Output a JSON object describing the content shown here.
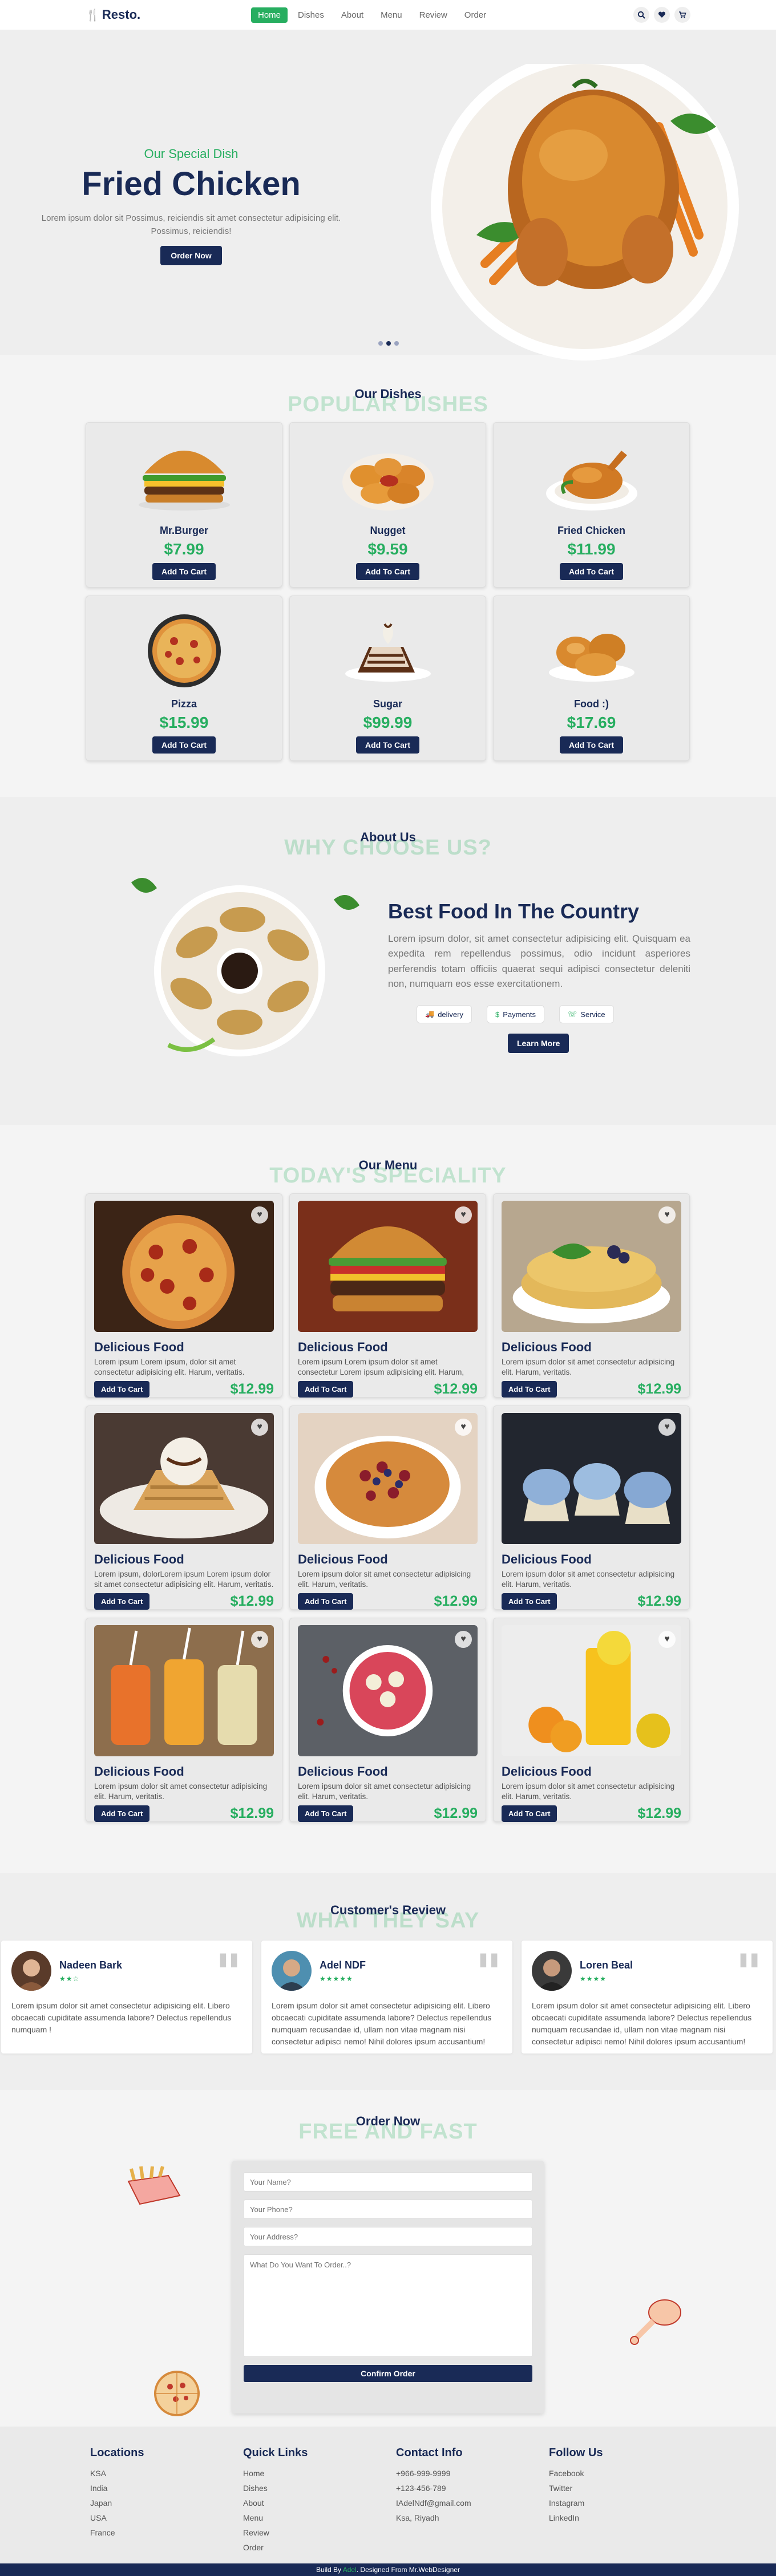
{
  "nav": {
    "logo": "Resto.",
    "links": [
      "Home",
      "Dishes",
      "About",
      "Menu",
      "Review",
      "Order"
    ],
    "icons": [
      "search-icon",
      "heart-icon",
      "cart-icon"
    ]
  },
  "hero": {
    "subtitle": "Our Special Dish",
    "title": "Fried Chicken",
    "description": "Lorem ipsum dolor sit Possimus, reiciendis sit amet consectetur adipisicing elit. Possimus, reiciendis!",
    "button": "Order Now"
  },
  "dishes": {
    "heading": "Our Dishes",
    "ghost": "POPULAR DISHES",
    "items": [
      {
        "name": "Mr.Burger",
        "price": "$7.99",
        "button": "Add To Cart"
      },
      {
        "name": "Nugget",
        "price": "$9.59",
        "button": "Add To Cart"
      },
      {
        "name": "Fried Chicken",
        "price": "$11.99",
        "button": "Add To Cart"
      },
      {
        "name": "Pizza",
        "price": "$15.99",
        "button": "Add To Cart"
      },
      {
        "name": "Sugar",
        "price": "$99.99",
        "button": "Add To Cart"
      },
      {
        "name": "Food :)",
        "price": "$17.69",
        "button": "Add To Cart"
      }
    ]
  },
  "about": {
    "heading": "About Us",
    "ghost": "WHY CHOOSE US?",
    "title": "Best Food In The Country",
    "text": "Lorem ipsum dolor, sit amet consectetur adipisicing elit. Quisquam ea expedita rem repellendus possimus, odio incidunt asperiores perferendis totam officiis quaerat sequi adipisci consectetur deleniti non, numquam eos esse exercitationem.",
    "badges": [
      "delivery",
      "Payments",
      "Service"
    ],
    "button": "Learn More"
  },
  "menu": {
    "heading": "Our Menu",
    "ghost": "TODAY'S SPECIALITY",
    "items": [
      {
        "title": "Delicious Food",
        "desc": "Lorem ipsum Lorem ipsum, dolor sit amet consectetur adipisicing elit. Harum, veritatis.",
        "price": "$12.99",
        "button": "Add To Cart"
      },
      {
        "title": "Delicious Food",
        "desc": "Lorem ipsum Lorem ipsum dolor sit amet consectetur Lorem ipsum adipisicing elit. Harum, veritatis.",
        "price": "$12.99",
        "button": "Add To Cart"
      },
      {
        "title": "Delicious Food",
        "desc": "Lorem ipsum dolor sit amet consectetur adipisicing elit. Harum, veritatis.",
        "price": "$12.99",
        "button": "Add To Cart"
      },
      {
        "title": "Delicious Food",
        "desc": "Lorem ipsum, dolorLorem ipsum Lorem ipsum dolor sit amet consectetur adipisicing elit. Harum, veritatis.",
        "price": "$12.99",
        "button": "Add To Cart"
      },
      {
        "title": "Delicious Food",
        "desc": "Lorem ipsum dolor sit amet consectetur adipisicing elit. Harum, veritatis.",
        "price": "$12.99",
        "button": "Add To Cart"
      },
      {
        "title": "Delicious Food",
        "desc": "Lorem ipsum dolor sit amet consectetur adipisicing elit. Harum, veritatis.",
        "price": "$12.99",
        "button": "Add To Cart"
      },
      {
        "title": "Delicious Food",
        "desc": "Lorem ipsum dolor sit amet consectetur adipisicing elit. Harum, veritatis.",
        "price": "$12.99",
        "button": "Add To Cart"
      },
      {
        "title": "Delicious Food",
        "desc": "Lorem ipsum dolor sit amet consectetur adipisicing elit. Harum, veritatis.",
        "price": "$12.99",
        "button": "Add To Cart"
      },
      {
        "title": "Delicious Food",
        "desc": "Lorem ipsum dolor sit amet consectetur adipisicing elit. Harum, veritatis.",
        "price": "$12.99",
        "button": "Add To Cart"
      }
    ]
  },
  "review": {
    "heading": "Customer's Review",
    "ghost": "WHAT THEY SAY",
    "items": [
      {
        "name": "Nadeen Bark",
        "stars": "★★☆",
        "text": "Lorem ipsum dolor sit amet consectetur adipisicing elit. Libero obcaecati cupiditate assumenda labore? Delectus repellendus numquam !"
      },
      {
        "name": "Adel NDF",
        "stars": "★★★★★",
        "text": "Lorem ipsum dolor sit amet consectetur adipisicing elit. Libero obcaecati cupiditate assumenda labore? Delectus repellendus numquam recusandae id, ullam non vitae magnam nisi consectetur adipisci nemo! Nihil dolores ipsum accusantium!"
      },
      {
        "name": "Loren Beal",
        "stars": "★★★★",
        "text": "Lorem ipsum dolor sit amet consectetur adipisicing elit. Libero obcaecati cupiditate assumenda labore? Delectus repellendus numquam recusandae id, ullam non vitae magnam nisi consectetur adipisci nemo! Nihil dolores ipsum accusantium!"
      }
    ]
  },
  "order": {
    "heading": "Order Now",
    "ghost": "FREE AND FAST",
    "name_ph": "Your Name?",
    "phone_ph": "Your Phone?",
    "address_ph": "Your Address?",
    "order_ph": "What Do You Want To Order..?",
    "button": "Confirm Order"
  },
  "footer": {
    "cols": [
      {
        "title": "Locations",
        "links": [
          "KSA",
          "India",
          "Japan",
          "USA",
          "France"
        ]
      },
      {
        "title": "Quick Links",
        "links": [
          "Home",
          "Dishes",
          "About",
          "Menu",
          "Review",
          "Order"
        ]
      },
      {
        "title": "Contact Info",
        "links": [
          "+966-999-9999",
          "+123-456-789",
          "IAdelNdf@gmail.com",
          "Ksa, Riyadh"
        ]
      },
      {
        "title": "Follow Us",
        "links": [
          "Facebook",
          "Twitter",
          "Instagram",
          "LinkedIn"
        ]
      }
    ],
    "credit_pre": "Build By",
    "credit_name": "Adel",
    "credit_post": ". Designed From Mr.WebDesigner"
  },
  "colors": {
    "primary": "#192a56",
    "accent": "#27ae60",
    "background": "#eeeeee"
  }
}
